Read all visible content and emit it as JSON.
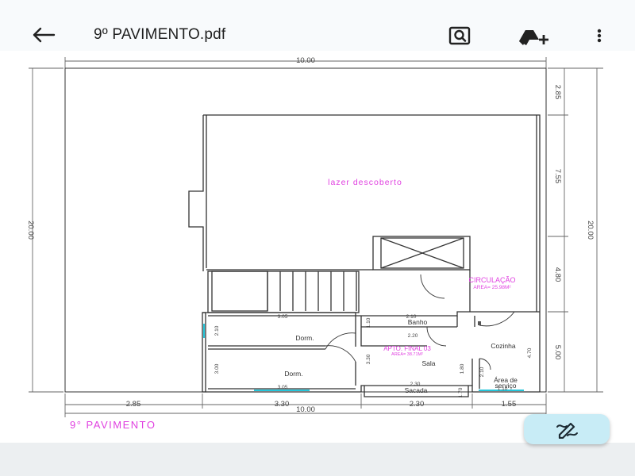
{
  "appbar": {
    "title": "9º PAVIMENTO.pdf",
    "back_icon": "arrow-back-icon",
    "search_icon": "search-document-icon",
    "drive_icon": "add-to-drive-icon",
    "menu_icon": "more-vert-icon"
  },
  "plan": {
    "dims": {
      "top_total": "10.00",
      "bottom_total": "10.00",
      "bottom_seg1": "2.85",
      "bottom_seg2": "3.30",
      "bottom_seg3": "2.30",
      "bottom_seg4": "1.55",
      "left_height": "20.00",
      "right_total": "20.00",
      "right_seg1": "2.85",
      "right_seg2": "7.55",
      "right_seg3": "4.80",
      "right_seg4": "5.00"
    },
    "labels": {
      "lazer": "lazer  descoberto",
      "circulacao": "CIRCULAÇÃO",
      "circulacao_area": "AREA= 25.98M²",
      "apto": "APTO. FINAL 03",
      "apto_area": "AREA= 38.71M²",
      "dorm1": "Dorm.",
      "dorm2": "Dorm.",
      "banho": "Banho",
      "cozinha": "Cozinha",
      "sala": "Sala",
      "sacada": "Sacada",
      "area_servico_1": "Área  de",
      "area_servico_2": "serviço",
      "dim_305_top": "3.05",
      "dim_305_bottom": "3.05",
      "dim_210_a": "2.10",
      "dim_210_b": "2.10",
      "dim_220": "2.20",
      "dim_230": "2.30",
      "dim_300": "3.00",
      "dim_330": "3.30",
      "dim_180": "1.80",
      "dim_170": "1.70",
      "dim_470": "4.70",
      "dim_110": "1.10",
      "dim_210_c": "2.10",
      "dim_110_b": "1.10"
    },
    "floor_title": "9°   PAVIMENTO",
    "colors": {
      "line": "#333333",
      "dim_line": "#555555",
      "magenta": "#e040e0",
      "cyan": "#26c6da"
    }
  },
  "fab": {
    "icon": "edit-pen-off-icon"
  }
}
